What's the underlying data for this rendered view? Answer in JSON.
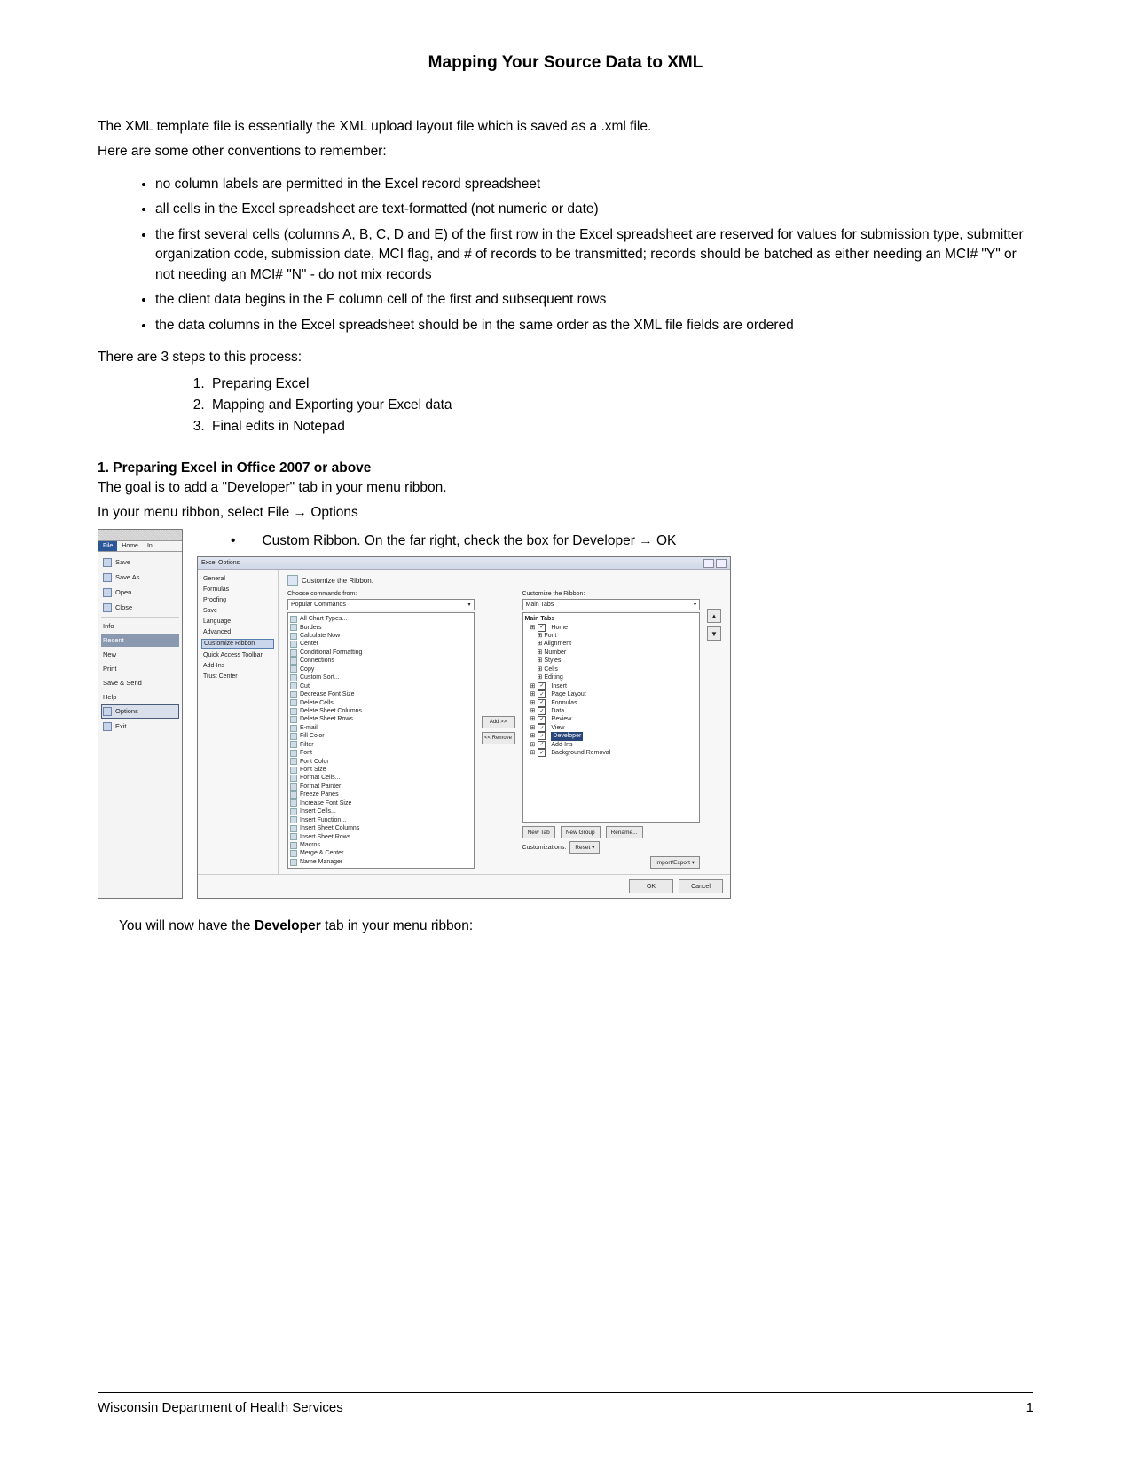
{
  "title": "Mapping Your Source Data to XML",
  "intro1": "The XML template file is essentially the XML upload layout file which is saved as a .xml file.",
  "intro2": "Here are some other conventions to remember:",
  "bullets": [
    "no column labels are permitted in the Excel record spreadsheet",
    "all cells in the Excel spreadsheet are text-formatted (not numeric or date)",
    "the first several cells (columns A, B, C, D and E) of the first row in the Excel spreadsheet are reserved for values for submission type, submitter organization code, submission date, MCI flag, and # of records to be transmitted; records should be batched as either needing an MCI# \"Y\" or not needing an MCI# \"N\" - do not mix records",
    "the client data begins in the F column cell of the first and subsequent rows",
    "the data columns in the Excel spreadsheet should be in the same order as the XML file fields are ordered"
  ],
  "steps_intro": "There are 3 steps to this process:",
  "steps": [
    "Preparing Excel",
    "Mapping and Exporting your Excel data",
    "Final edits in Notepad"
  ],
  "section1_head": "1.   Preparing Excel in Office 2007 or above",
  "section1_p1": "The goal is to add a \"Developer\" tab in your menu ribbon.",
  "section1_p2": "In your menu ribbon, select File → Options",
  "ribbon_bullet": "Custom Ribbon. On the far right, check the box for Developer → OK",
  "after_screens_prefix": "You will now have the ",
  "after_screens_bold": "Developer",
  "after_screens_suffix": " tab in your menu ribbon:",
  "file_menu": {
    "tab_file": "File",
    "tab_home": "Home",
    "tab_in": "In",
    "items_top": [
      "Save",
      "Save As",
      "Open",
      "Close"
    ],
    "info": "Info",
    "recent": "Recent",
    "new": "New",
    "print": "Print",
    "save_send": "Save & Send",
    "help": "Help",
    "options": "Options",
    "exit": "Exit"
  },
  "options_dialog": {
    "title": "Excel Options",
    "sidebar": [
      "General",
      "Formulas",
      "Proofing",
      "Save",
      "Language",
      "Advanced",
      "Customize Ribbon",
      "Quick Access Toolbar",
      "Add-Ins",
      "Trust Center"
    ],
    "heading": "Customize the Ribbon.",
    "left_label": "Choose commands from:",
    "left_dd": "Popular Commands",
    "left_list": [
      "All Chart Types...",
      "Borders",
      "Calculate Now",
      "Center",
      "Conditional Formatting",
      "Connections",
      "Copy",
      "Custom Sort...",
      "Cut",
      "Decrease Font Size",
      "Delete Cells...",
      "Delete Sheet Columns",
      "Delete Sheet Rows",
      "E-mail",
      "Fill Color",
      "Filter",
      "Font",
      "Font Color",
      "Font Size",
      "Format Cells...",
      "Format Painter",
      "Freeze Panes",
      "Increase Font Size",
      "Insert Cells...",
      "Insert Function...",
      "Insert Sheet Columns",
      "Insert Sheet Rows",
      "Macros",
      "Merge & Center",
      "Name Manager"
    ],
    "add_btn": "Add >>",
    "remove_btn": "<< Remove",
    "right_label": "Customize the Ribbon:",
    "right_dd": "Main Tabs",
    "tree_root": "Main Tabs",
    "tree": [
      {
        "label": "Home",
        "checked": true,
        "children": [
          "Font",
          "Alignment",
          "Number",
          "Styles",
          "Cells",
          "Editing"
        ]
      },
      {
        "label": "Insert",
        "checked": true
      },
      {
        "label": "Page Layout",
        "checked": true
      },
      {
        "label": "Formulas",
        "checked": true
      },
      {
        "label": "Data",
        "checked": true
      },
      {
        "label": "Review",
        "checked": true
      },
      {
        "label": "View",
        "checked": true
      },
      {
        "label": "Developer",
        "checked": true,
        "highlight": true
      },
      {
        "label": "Add-Ins",
        "checked": true
      },
      {
        "label": "Background Removal",
        "checked": true
      }
    ],
    "new_tab": "New Tab",
    "new_group": "New Group",
    "rename": "Rename...",
    "customizations": "Customizations:",
    "reset": "Reset ▾",
    "import_export": "Import/Export ▾",
    "ok": "OK",
    "cancel": "Cancel"
  },
  "footer_left": "Wisconsin Department of Health Services",
  "footer_right": "1"
}
